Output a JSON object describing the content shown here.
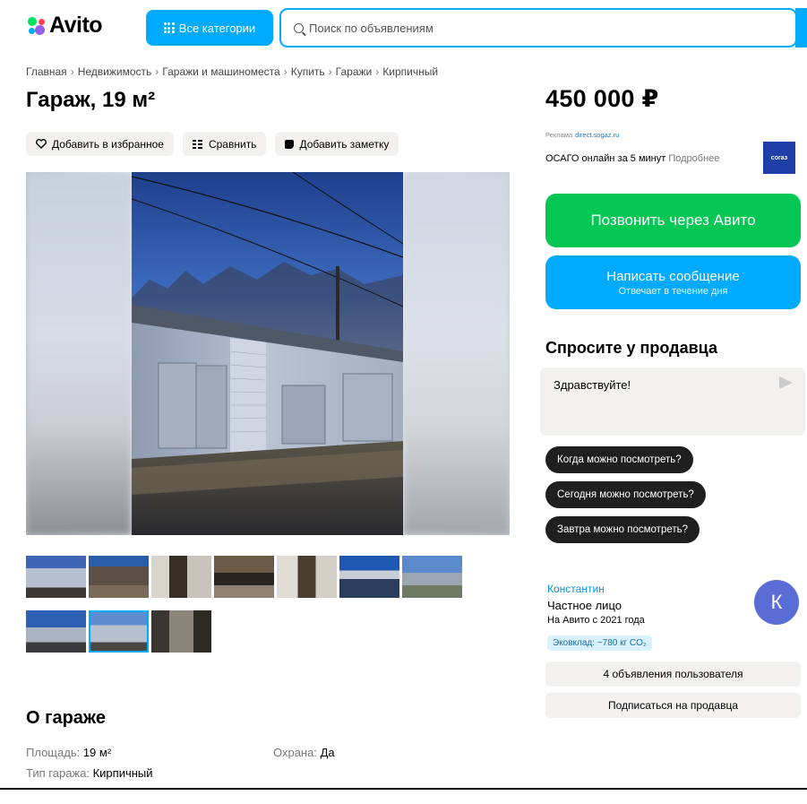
{
  "header": {
    "logo_text": "Avito",
    "categories_label": "Все категории",
    "search_placeholder": "Поиск по объявлениям"
  },
  "breadcrumb": [
    "Главная",
    "Недвижимость",
    "Гаражи и машиноместа",
    "Купить",
    "Гаражи",
    "Кирпичный"
  ],
  "listing": {
    "title": "Гараж, 19 м²",
    "actions": {
      "favorite": "Добавить в избранное",
      "compare": "Сравнить",
      "note": "Добавить заметку"
    },
    "thumbnail_count": 10,
    "active_thumbnail": 9,
    "about_title": "О гараже",
    "params": [
      {
        "key": "Площадь",
        "value": "19 м²"
      },
      {
        "key": "Тип гаража",
        "value": "Кирпичный"
      },
      {
        "key": "Охрана",
        "value": "Да"
      }
    ]
  },
  "sidebar": {
    "price": "450 000 ₽",
    "ad": {
      "label": "Реклама",
      "domain": "direct.sogaz.ru",
      "text": "ОСАГО онлайн за 5 минут",
      "more": "Подробнее",
      "logo": "согаз"
    },
    "call_button": "Позвонить через Авито",
    "message_button": "Написать сообщение",
    "message_sub": "Отвечает в течение дня",
    "ask_title": "Спросите у продавца",
    "ask_value": "Здравствуйте!",
    "quick_questions": [
      "Когда можно посмотреть?",
      "Сегодня можно посмотреть?",
      "Завтра можно посмотреть?"
    ],
    "seller": {
      "name": "Константин",
      "type": "Частное лицо",
      "since": "На Авито с 2021 года",
      "eco": "Эковклад: ~780 кг CO₂",
      "avatar_letter": "К",
      "listings_button": "4 объявления пользователя",
      "subscribe_button": "Подписаться на продавца"
    }
  },
  "colors": {
    "accent": "#00aaff",
    "call": "#04c754",
    "chip": "#1f1f1f",
    "avatar": "#5a6cd6"
  }
}
